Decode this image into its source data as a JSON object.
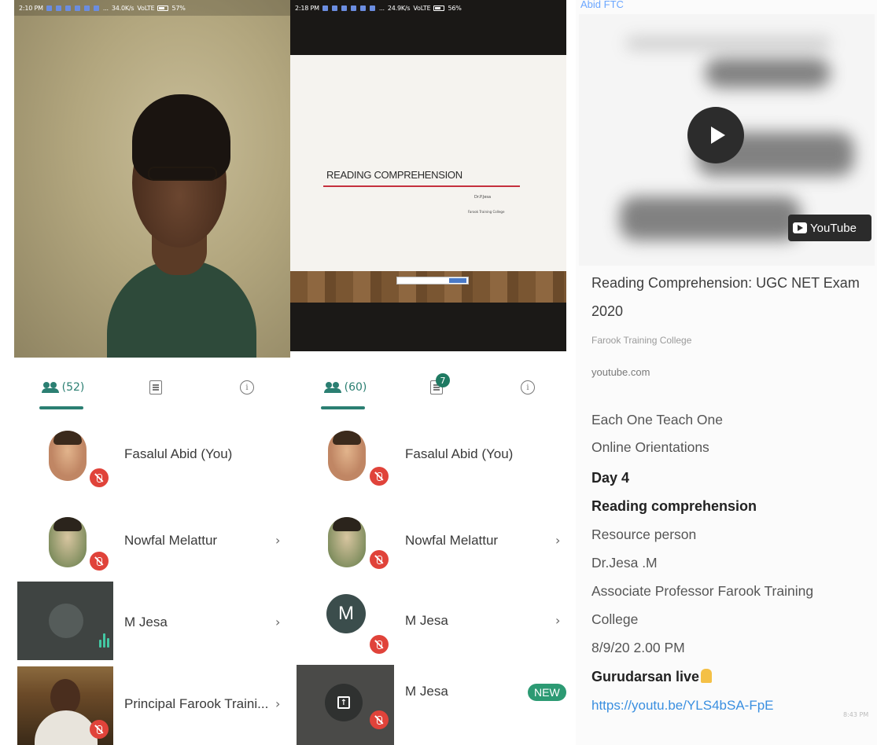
{
  "panels": [
    {
      "status": {
        "time": "2:10 PM",
        "speed": "34.0K/s",
        "network": "VoLTE",
        "battery": "57%"
      },
      "tabs": {
        "people_count": "(52)"
      },
      "participants": [
        {
          "name": "Fasalul Abid (You)"
        },
        {
          "name": "Nowfal Melattur",
          "chevron": "›"
        },
        {
          "name": "M Jesa",
          "chevron": "›"
        },
        {
          "name": "Principal Farook Traini...",
          "chevron": "›"
        }
      ]
    },
    {
      "status": {
        "time": "2:18 PM",
        "speed": "24.9K/s",
        "network": "VoLTE",
        "battery": "56%"
      },
      "presentation": {
        "title": "READING COMPREHENSION",
        "presenter": "Dr.P.Jesa",
        "institution": "Farook Training College"
      },
      "tabs": {
        "people_count": "(60)",
        "chat_badge": "7"
      },
      "participants": [
        {
          "name": "Fasalul Abid (You)"
        },
        {
          "name": "Nowfal Melattur",
          "chevron": "›"
        },
        {
          "name": "M Jesa",
          "initial": "M",
          "chevron": "›"
        },
        {
          "name": "M Jesa",
          "badge": "NEW"
        }
      ]
    }
  ],
  "chat": {
    "sender": "Abid FTC",
    "youtube_logo": "YouTube",
    "link_preview": {
      "title": "Reading Comprehension: UGC NET Exam 2020",
      "channel": "Farook Training College",
      "domain": "youtube.com"
    },
    "lines": [
      {
        "text": "Each One Teach One",
        "style": "normal"
      },
      {
        "text": "Online Orientations",
        "style": "normal"
      },
      {
        "text": "Day 4",
        "style": "bold"
      },
      {
        "text": "Reading comprehension",
        "style": "bold"
      },
      {
        "text": "Resource person",
        "style": "normal"
      },
      {
        "text": "Dr.Jesa .M",
        "style": "normal"
      },
      {
        "text": "Associate Professor Farook Training",
        "style": "normal"
      },
      {
        "text": "College",
        "style": "normal"
      },
      {
        "text": "8/9/20  2.00 PM",
        "style": "normal"
      },
      {
        "text": "Gurudarsan live",
        "style": "bold"
      },
      {
        "text": "https://youtu.be/YLS4bSA-FpE",
        "style": "link"
      }
    ],
    "time": "8:43 PM"
  },
  "colors": {
    "accent_teal": "#2b7f72",
    "mute_red": "#e0433a",
    "new_green": "#2c9a73",
    "link_blue": "#3a8fe0"
  }
}
